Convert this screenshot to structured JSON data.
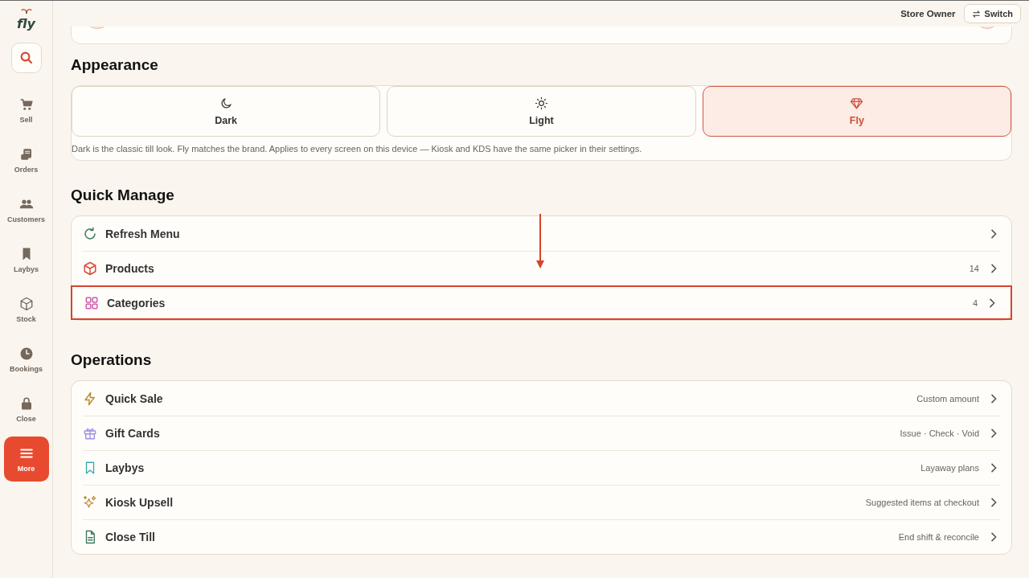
{
  "sidebar": {
    "logo": "fly",
    "items": [
      {
        "label": "Sell",
        "selected": false
      },
      {
        "label": "Orders",
        "selected": false
      },
      {
        "label": "Customers",
        "selected": false
      },
      {
        "label": "Laybys",
        "selected": false
      },
      {
        "label": "Stock",
        "selected": false
      },
      {
        "label": "Bookings",
        "selected": false
      },
      {
        "label": "Close",
        "selected": false
      },
      {
        "label": "More",
        "selected": true
      }
    ]
  },
  "header": {
    "user": "Store Owner",
    "switch_button": "Switch"
  },
  "appearance": {
    "title": "Appearance",
    "options": [
      {
        "label": "Dark",
        "selected": false
      },
      {
        "label": "Light",
        "selected": false
      },
      {
        "label": "Fly",
        "selected": true
      }
    ],
    "description": "Dark is the classic till look. Fly matches the brand. Applies to every screen on this device — Kiosk and KDS have the same picker in their settings."
  },
  "quick_manage": {
    "title": "Quick Manage",
    "items": [
      {
        "label": "Refresh Menu",
        "highlighted": false
      },
      {
        "label": "Products",
        "detail": "14",
        "highlighted": false
      },
      {
        "label": "Categories",
        "detail": "4",
        "highlighted": true
      }
    ]
  },
  "operations": {
    "title": "Operations",
    "items": [
      {
        "label": "Quick Sale",
        "detail": "Custom amount",
        "highlighted": false
      },
      {
        "label": "Gift Cards",
        "detail": "Issue · Check · Void",
        "highlighted": false
      },
      {
        "label": "Laybys",
        "detail": "Layaway plans",
        "highlighted": false
      },
      {
        "label": "Kiosk Upsell",
        "detail": "Suggested items at checkout",
        "highlighted": false
      },
      {
        "label": "Close Till",
        "detail": "End shift & reconcile",
        "highlighted": false
      }
    ]
  }
}
